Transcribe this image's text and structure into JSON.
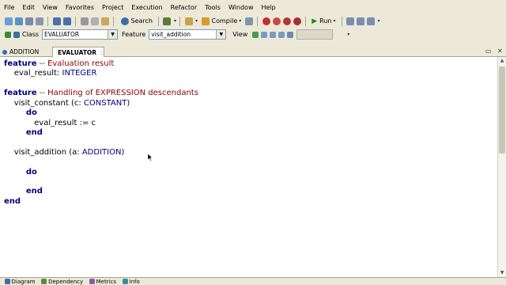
{
  "menu": [
    "File",
    "Edit",
    "View",
    "Favorites",
    "Project",
    "Execution",
    "Refactor",
    "Tools",
    "Window",
    "Help"
  ],
  "toolbar": {
    "search_label": "Search",
    "compile_label": "Compile",
    "run_label": "Run"
  },
  "context_bar": {
    "class_label": "Class",
    "class_value": "EVALUATOR",
    "feature_label": "Feature",
    "feature_value": "visit_addition",
    "view_label": "View"
  },
  "tabs": [
    {
      "label": "ADDITION",
      "active": false
    },
    {
      "label": "EVALUATOR",
      "active": true
    }
  ],
  "code_lines": [
    [
      {
        "t": "kw",
        "s": "feature"
      },
      {
        "t": "cm",
        "s": " -- Evaluation result"
      }
    ],
    [
      {
        "t": "id",
        "s": "    eval_result: "
      },
      {
        "t": "ty",
        "s": "INTEGER"
      }
    ],
    [],
    [
      {
        "t": "kw",
        "s": "feature"
      },
      {
        "t": "cm",
        "s": " -- Handling of EXPRESSION descendants"
      }
    ],
    [
      {
        "t": "id",
        "s": "    visit_constant (c: "
      },
      {
        "t": "ty",
        "s": "CONSTANT"
      },
      {
        "t": "id",
        "s": ")"
      }
    ],
    [
      {
        "t": "kw",
        "s": "        do"
      }
    ],
    [
      {
        "t": "id",
        "s": "            eval_result := c"
      }
    ],
    [
      {
        "t": "kw",
        "s": "        end"
      }
    ],
    [],
    [
      {
        "t": "id",
        "s": "    visit_addition (a: "
      },
      {
        "t": "ty",
        "s": "ADDITION"
      },
      {
        "t": "id",
        "s": ")"
      }
    ],
    [],
    [
      {
        "t": "kw",
        "s": "        do"
      }
    ],
    [],
    [
      {
        "t": "kw",
        "s": "        end"
      }
    ],
    [
      {
        "t": "kw",
        "s": "end"
      }
    ]
  ],
  "bottom_tabs": [
    "Diagram",
    "Dependency",
    "Metrics",
    "Info"
  ],
  "colors": {
    "keyword": "#000080",
    "comment": "#8b0000",
    "chrome": "#ece9d8"
  }
}
